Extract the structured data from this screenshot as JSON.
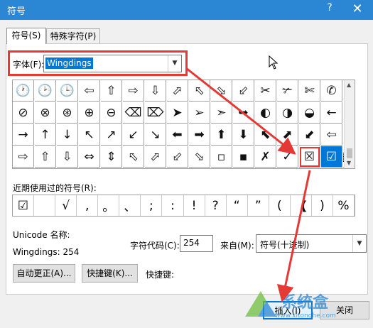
{
  "window": {
    "title": "符号",
    "help": "?",
    "close": "✕"
  },
  "tabs": [
    {
      "label": "符号(S)"
    },
    {
      "label": "特殊字符(P)"
    }
  ],
  "font": {
    "label": "字体(F):",
    "value": "Wingdings"
  },
  "grid_rows": [
    [
      "🕐",
      "🕑",
      "🕒",
      "⇦",
      "⇧",
      "⇨",
      "⇩",
      "⬀",
      "⬁",
      "⬂",
      "⬃",
      "✂",
      "✃",
      "✄",
      "✆"
    ],
    [
      "⊘",
      "⊗",
      "⊛",
      "⊕",
      "⊖",
      "⌫",
      "⌦",
      "➤",
      "➢",
      "➣",
      "➥",
      "◐",
      "◑",
      "◒",
      "←"
    ],
    [
      "→",
      "↑",
      "↓",
      "↖",
      "↗",
      "↙",
      "↘",
      "⬅",
      "➡",
      "⬆",
      "⬇",
      "⬉",
      "⬈",
      "⬋",
      "⇦"
    ],
    [
      "⇨",
      "⇧",
      "⇩",
      "⇔",
      "⇕",
      "⬁",
      "⬀",
      "⬃",
      "⬂",
      "▫",
      "▪",
      "✗",
      "✓",
      "☒",
      "☑"
    ]
  ],
  "grid_last_extra": "▦",
  "recent": {
    "label": "近期使用过的符号(R):",
    "items": [
      "☑",
      "",
      "√",
      ",",
      "。",
      "、",
      ";",
      ":",
      "!",
      "?",
      "“",
      "”",
      "(",
      "【",
      ")",
      "%"
    ]
  },
  "unicode": {
    "name_label": "Unicode 名称:",
    "name_value": "Wingdings: 254"
  },
  "char_code": {
    "label": "字符代码(C):",
    "value": "254"
  },
  "from": {
    "label": "来自(M):",
    "value": "符号(十进制)"
  },
  "buttons": {
    "autocorrect": "自动更正(A)...",
    "shortcut_key": "快捷键(K)...",
    "shortcut_label": "快捷键:",
    "insert": "插入(I)",
    "close": "关闭"
  },
  "watermark": {
    "text": "系统盒",
    "url": "www.xitonghe.com"
  },
  "colors": {
    "titlebar": "#2b87d3",
    "selection": "#0078d7",
    "annotation": "#e53935"
  }
}
